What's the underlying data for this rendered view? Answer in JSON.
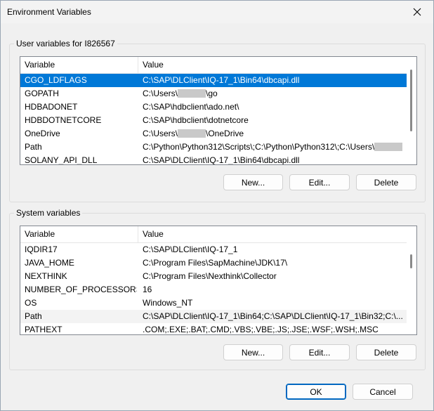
{
  "window": {
    "title": "Environment Variables"
  },
  "user_section": {
    "label": "User variables for I826567",
    "columns": {
      "variable": "Variable",
      "value": "Value"
    },
    "rows": [
      {
        "name": "CGO_LDFLAGS",
        "pre": "C:\\SAP\\DLClient\\IQ-17_1\\Bin64\\dbcapi.dll",
        "post": "",
        "selected": true
      },
      {
        "name": "GOPATH",
        "pre": "C:\\Users\\",
        "post": "\\go",
        "redacted": true
      },
      {
        "name": "HDBADONET",
        "pre": "C:\\SAP\\hdbclient\\ado.net\\",
        "post": ""
      },
      {
        "name": "HDBDOTNETCORE",
        "pre": "C:\\SAP\\hdbclient\\dotnetcore",
        "post": ""
      },
      {
        "name": "OneDrive",
        "pre": "C:\\Users\\",
        "post": "\\OneDrive",
        "redacted": true
      },
      {
        "name": "Path",
        "pre": "C:\\Python\\Python312\\Scripts\\;C:\\Python\\Python312\\;C:\\Users\\",
        "post": "",
        "redacted": true
      },
      {
        "name": "SOLANY_API_DLL",
        "pre": "C:\\SAP\\DLClient\\IQ-17_1\\Bin64\\dbcapi.dll",
        "post": ""
      }
    ],
    "buttons": {
      "new": "New...",
      "edit": "Edit...",
      "delete": "Delete"
    }
  },
  "system_section": {
    "label": "System variables",
    "columns": {
      "variable": "Variable",
      "value": "Value"
    },
    "rows": [
      {
        "name": "IQDIR17",
        "pre": "C:\\SAP\\DLClient\\IQ-17_1",
        "post": ""
      },
      {
        "name": "JAVA_HOME",
        "pre": "C:\\Program Files\\SapMachine\\JDK\\17\\",
        "post": ""
      },
      {
        "name": "NEXTHINK",
        "pre": "C:\\Program Files\\Nexthink\\Collector",
        "post": ""
      },
      {
        "name": "NUMBER_OF_PROCESSORS",
        "pre": "16",
        "post": ""
      },
      {
        "name": "OS",
        "pre": "Windows_NT",
        "post": ""
      },
      {
        "name": "Path",
        "pre": "C:\\SAP\\DLClient\\IQ-17_1\\Bin64;C:\\SAP\\DLClient\\IQ-17_1\\Bin32;C:\\...",
        "post": "",
        "hover": true
      },
      {
        "name": "PATHEXT",
        "pre": ".COM;.EXE;.BAT;.CMD;.VBS;.VBE;.JS;.JSE;.WSF;.WSH;.MSC",
        "post": ""
      }
    ],
    "buttons": {
      "new": "New...",
      "edit": "Edit...",
      "delete": "Delete"
    }
  },
  "footer": {
    "ok": "OK",
    "cancel": "Cancel"
  },
  "colors": {
    "selection": "#0078d7",
    "default_button_border": "#0067c0",
    "window_bg": "#f0f0f0"
  },
  "icons": {
    "close": "close-icon"
  }
}
